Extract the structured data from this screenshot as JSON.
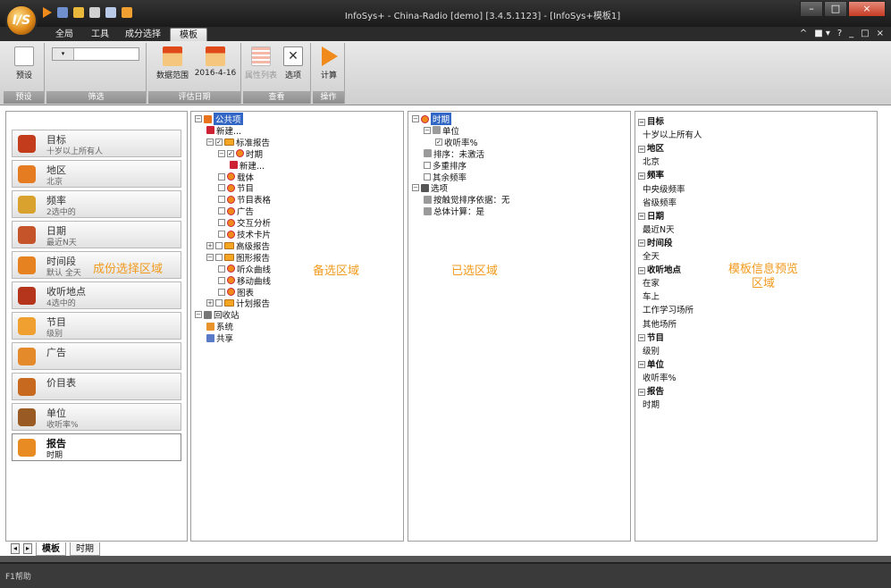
{
  "app": {
    "logo_text": "I/S",
    "title": "InfoSys+ - China-Radio  [demo]  [3.4.5.1123] - [InfoSys+模板1]",
    "window_buttons": [
      "–",
      "□",
      "×"
    ]
  },
  "ribbon_tabs": [
    {
      "label": "全局"
    },
    {
      "label": "工具"
    },
    {
      "label": "成分选择"
    },
    {
      "label": "模板",
      "active": true
    }
  ],
  "ribbon_right": [
    "^",
    "■ ▾",
    "?",
    "_",
    "□",
    "×"
  ],
  "ribbon": {
    "groups": [
      {
        "label": "预设",
        "buttons": [
          {
            "label": "预设",
            "icon": "new-doc-icon"
          }
        ]
      },
      {
        "label": "筛选",
        "combo_value": ""
      },
      {
        "label": "评估日期",
        "buttons": [
          {
            "label": "数据范围",
            "icon": "calendar-range-icon"
          },
          {
            "label": "2016-4-16",
            "icon": "calendar-day-icon"
          }
        ]
      },
      {
        "label": "查看",
        "buttons": [
          {
            "label": "属性列表",
            "icon": "list-icon"
          },
          {
            "label": "选项",
            "icon": "tools-icon"
          }
        ]
      },
      {
        "label": "操作",
        "buttons": [
          {
            "label": "计算",
            "icon": "play-icon"
          }
        ]
      }
    ]
  },
  "nav": {
    "items": [
      {
        "title": "目标",
        "sub": "十岁以上所有人",
        "icon": "audience-icon",
        "color": "#c33c1c"
      },
      {
        "title": "地区",
        "sub": "北京",
        "icon": "globe-icon",
        "color": "#e67c22"
      },
      {
        "title": "频率",
        "sub": "2选中的",
        "icon": "radio-wave-icon",
        "color": "#d9a22e"
      },
      {
        "title": "日期",
        "sub": "最近N天",
        "icon": "calendar-icon",
        "color": "#c6542a"
      },
      {
        "title": "时间段",
        "sub": "默认 全天",
        "icon": "clock-icon",
        "color": "#e6821f"
      },
      {
        "title": "收听地点",
        "sub": "4选中的",
        "icon": "family-icon",
        "color": "#b5341c"
      },
      {
        "title": "节目",
        "sub": "级别",
        "icon": "program-icon",
        "color": "#f0a030"
      },
      {
        "title": "广告",
        "sub": "",
        "icon": "funnel-icon",
        "color": "#e48a2a"
      },
      {
        "title": "价目表",
        "sub": "",
        "icon": "coins-icon",
        "color": "#c76a1f"
      },
      {
        "title": "单位",
        "sub": "收听率%",
        "icon": "ruler-icon",
        "color": "#9a5a24"
      },
      {
        "title": "报告",
        "sub": "时期",
        "icon": "report-icon",
        "color": "#e88b22",
        "active": true
      }
    ]
  },
  "overlays": {
    "component_area": "成份选择区域",
    "candidate_area": "备选区域",
    "selected_area": "已选区域",
    "preview_area": "模板信息预览\n区域"
  },
  "candidate_tree": [
    {
      "label": "公共项",
      "depth": 0,
      "exp": "−",
      "kind": "book",
      "selected": true
    },
    {
      "label": "新建...",
      "depth": 1,
      "kind": "pen"
    },
    {
      "label": "标准报告",
      "depth": 1,
      "exp": "−",
      "chk": "✓",
      "kind": "folder"
    },
    {
      "label": "时期",
      "depth": 2,
      "exp": "−",
      "chk": "✓",
      "kind": "dot"
    },
    {
      "label": "新建...",
      "depth": 3,
      "kind": "pen"
    },
    {
      "label": "载体",
      "depth": 2,
      "chk": "",
      "kind": "dot"
    },
    {
      "label": "节目",
      "depth": 2,
      "chk": "",
      "kind": "dot"
    },
    {
      "label": "节目表格",
      "depth": 2,
      "chk": "",
      "kind": "dot"
    },
    {
      "label": "广告",
      "depth": 2,
      "chk": "",
      "kind": "dot"
    },
    {
      "label": "交互分析",
      "depth": 2,
      "chk": "",
      "kind": "dot"
    },
    {
      "label": "技术卡片",
      "depth": 2,
      "chk": "",
      "kind": "dot"
    },
    {
      "label": "高级报告",
      "depth": 1,
      "exp": "+",
      "chk": "",
      "kind": "folder"
    },
    {
      "label": "图形报告",
      "depth": 1,
      "exp": "−",
      "chk": "",
      "kind": "folder"
    },
    {
      "label": "听众曲线",
      "depth": 2,
      "chk": "",
      "kind": "dot"
    },
    {
      "label": "移动曲线",
      "depth": 2,
      "chk": "",
      "kind": "dot"
    },
    {
      "label": "图表",
      "depth": 2,
      "chk": "",
      "kind": "dot"
    },
    {
      "label": "计划报告",
      "depth": 1,
      "exp": "+",
      "chk": "",
      "kind": "folder"
    },
    {
      "label": "回收站",
      "depth": 0,
      "exp": "−",
      "kind": "trash"
    },
    {
      "label": "系统",
      "depth": 1,
      "kind": "db"
    },
    {
      "label": "共享",
      "depth": 1,
      "kind": "people"
    }
  ],
  "selected_tree": [
    {
      "label": "时期",
      "depth": 0,
      "exp": "−",
      "kind": "dot",
      "selected": true
    },
    {
      "label": "单位",
      "depth": 1,
      "exp": "−",
      "kind": "gear"
    },
    {
      "label": "收听率%",
      "depth": 2,
      "chk": "✓",
      "kind": "none"
    },
    {
      "label": "排序：未激活",
      "depth": 1,
      "kind": "gear"
    },
    {
      "label": "多重排序",
      "depth": 1,
      "chk": "",
      "kind": "none"
    },
    {
      "label": "其余频率",
      "depth": 1,
      "chk": "",
      "kind": "none"
    },
    {
      "label": "选项",
      "depth": 0,
      "exp": "−",
      "kind": "wrench"
    },
    {
      "label": "按触觉排序依据：无",
      "depth": 1,
      "kind": "gear"
    },
    {
      "label": "总体计算：是",
      "depth": 1,
      "kind": "gear"
    }
  ],
  "preview": [
    {
      "text": "目标",
      "head": true
    },
    {
      "text": "十岁以上所有人"
    },
    {
      "text": "地区",
      "head": true
    },
    {
      "text": "北京"
    },
    {
      "text": "频率",
      "head": true
    },
    {
      "text": "中央级频率"
    },
    {
      "text": "省级频率"
    },
    {
      "text": "日期",
      "head": true
    },
    {
      "text": "最近N天"
    },
    {
      "text": "时间段",
      "head": true
    },
    {
      "text": "全天"
    },
    {
      "text": "收听地点",
      "head": true
    },
    {
      "text": "在家"
    },
    {
      "text": "车上"
    },
    {
      "text": "工作学习场所"
    },
    {
      "text": "其他场所"
    },
    {
      "text": "节目",
      "head": true
    },
    {
      "text": "级别"
    },
    {
      "text": "单位",
      "head": true
    },
    {
      "text": "收听率%"
    },
    {
      "text": "报告",
      "head": true
    },
    {
      "text": "时期"
    }
  ],
  "bottom_tabs": [
    {
      "label": "模板",
      "active": true
    },
    {
      "label": "时期"
    }
  ],
  "status": {
    "text": "F1帮助"
  }
}
